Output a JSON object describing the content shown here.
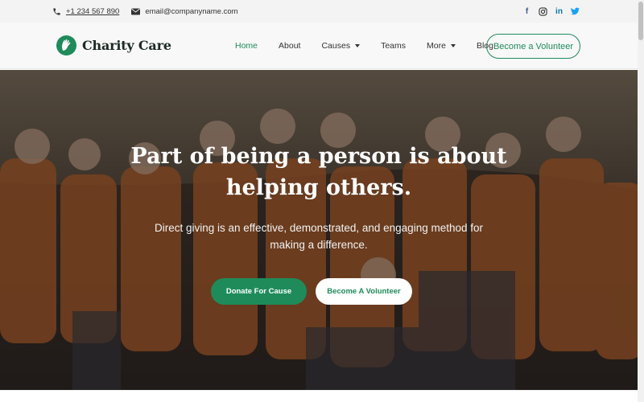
{
  "topbar": {
    "phone": "+1 234 567 890",
    "email": "email@companyname.com",
    "social": [
      {
        "name": "facebook-icon",
        "glyph": "f",
        "color": "#3b5998"
      },
      {
        "name": "instagram-icon",
        "glyph": "◎",
        "color": "#333333"
      },
      {
        "name": "linkedin-icon",
        "glyph": "in",
        "color": "#0e76a8"
      },
      {
        "name": "twitter-icon",
        "glyph": "✦",
        "color": "#1da1f2"
      }
    ]
  },
  "brand": {
    "name": "Charity Care",
    "accent": "#1f8b5b"
  },
  "nav": {
    "items": [
      {
        "label": "Home",
        "active": true,
        "dropdown": false
      },
      {
        "label": "About",
        "active": false,
        "dropdown": false
      },
      {
        "label": "Causes",
        "active": false,
        "dropdown": true
      },
      {
        "label": "Teams",
        "active": false,
        "dropdown": false
      },
      {
        "label": "More",
        "active": false,
        "dropdown": true
      },
      {
        "label": "Blog",
        "active": false,
        "dropdown": false
      }
    ],
    "cta": "Become a Volunteer"
  },
  "hero": {
    "heading_line1": "Part of being a person is about",
    "heading_line2": "helping others.",
    "subtext": "Direct giving is an effective, demonstrated, and engaging method for making a difference.",
    "primary_button": "Donate For Cause",
    "secondary_button": "Become A Volunteer"
  }
}
